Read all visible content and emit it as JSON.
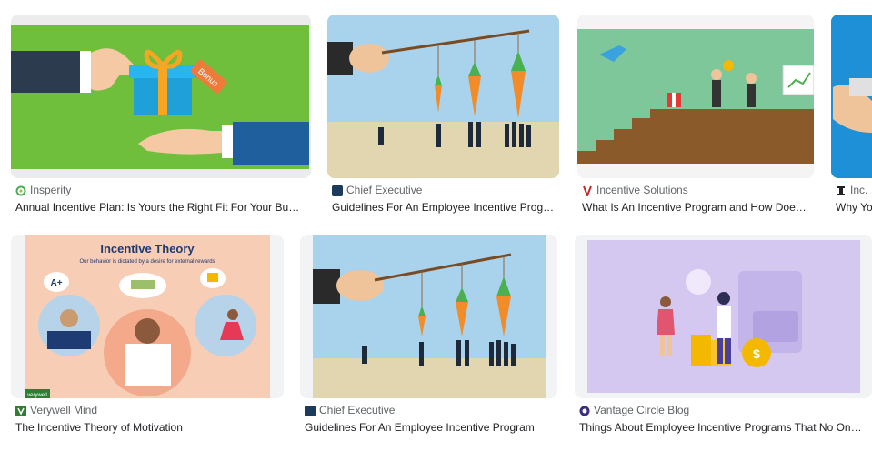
{
  "results": [
    {
      "source": "Insperity",
      "title": "Annual Incentive Plan: Is Yours the Right Fit For Your Business?",
      "favicon": "insperity-icon",
      "image_text": "Bonus"
    },
    {
      "source": "Chief Executive",
      "title": "Guidelines For An Employee Incentive Program",
      "favicon": "chief-executive-icon"
    },
    {
      "source": "Incentive Solutions",
      "title": "What Is An Incentive Program and How Does It Work?",
      "favicon": "incentive-solutions-icon"
    },
    {
      "source": "Inc.",
      "title": "Why You Should Offer Incentives",
      "favicon": "inc-icon"
    },
    {
      "source": "Verywell Mind",
      "title": "The Incentive Theory of Motivation",
      "favicon": "verywell-icon",
      "image_text": {
        "heading": "Incentive Theory",
        "subheading": "Our behavior is dictated by a desire for external rewards",
        "grade": "A+",
        "watermark": "verywell"
      }
    },
    {
      "source": "Chief Executive",
      "title": "Guidelines For An Employee Incentive Program",
      "favicon": "chief-executive-icon"
    },
    {
      "source": "Vantage Circle Blog",
      "title": "Things About Employee Incentive Programs That No One Tells You",
      "favicon": "vantage-circle-icon",
      "image_text": "$"
    }
  ],
  "colors": {
    "source_text": "#5f6368",
    "title_text": "#202124",
    "card_bg": "#f1f3f4"
  }
}
